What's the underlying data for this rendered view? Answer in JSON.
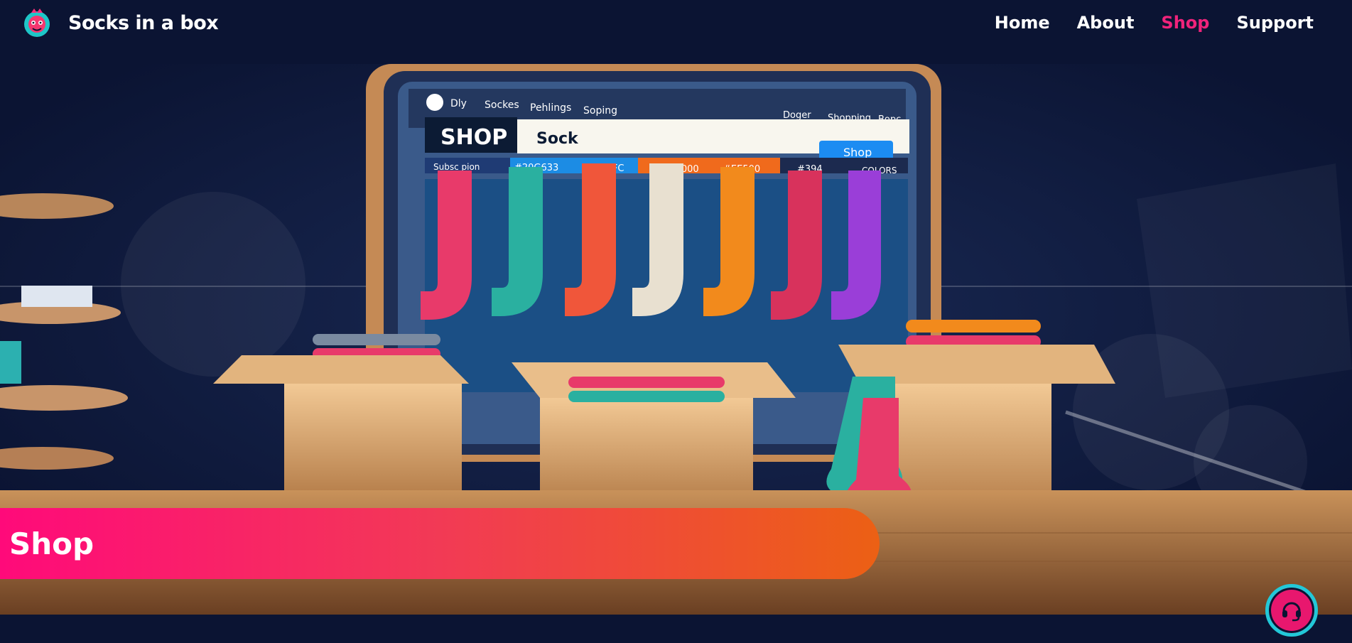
{
  "brand": {
    "name": "Socks in a box",
    "logo_icon": "sock-mascot-icon"
  },
  "nav": {
    "items": [
      {
        "label": "Home"
      },
      {
        "label": "About"
      },
      {
        "label": "Shop",
        "active": true
      },
      {
        "label": "Support"
      }
    ],
    "active_color": "#f0237b"
  },
  "hero": {
    "illustration": "laptop-sock-shop-illustration",
    "screen": {
      "menu": [
        "Dly",
        "Sockes",
        "Pehlings",
        "Soping"
      ],
      "menu_right": [
        "Doger",
        "Shopping",
        "Bopc"
      ],
      "shop_label": "SHOP",
      "search_text": "Sock",
      "button_label": "Shop",
      "color_strip": [
        "Subsc pion",
        "#20G633",
        "#200EFC",
        "#EF0D000",
        "#EE500",
        "#394",
        "COLORS"
      ]
    }
  },
  "banner": {
    "title": "Shop"
  },
  "support": {
    "icon": "headset-icon"
  },
  "colors": {
    "background": "#0b1433",
    "banner_start": "#ff0a7a",
    "banner_end": "#ec6014",
    "fab_ring": "#22c8d8"
  }
}
